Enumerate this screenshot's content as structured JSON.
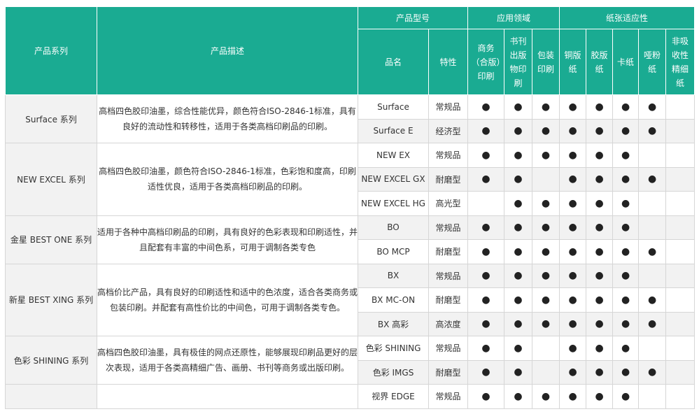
{
  "header": {
    "series": "产品系列",
    "description": "产品描述",
    "model_group": "产品型号",
    "app_group": "应用领域",
    "paper_group": "纸张适应性",
    "name": "品名",
    "feature": "特性",
    "app_cols": [
      "商务（合版）印刷",
      "书刊出版物印刷",
      "包装印刷"
    ],
    "paper_cols": [
      "铜版纸",
      "胶版纸",
      "卡纸",
      "哑粉纸",
      "非吸收性精细纸"
    ]
  },
  "groups": [
    {
      "series": "Surface 系列",
      "description": "高档四色胶印油墨，综合性能优异，颜色符合ISO-2846-1标准，具有良好的流动性和转移性，适用于各类高档印刷品的印刷。",
      "rows": [
        {
          "name": "Surface",
          "feature": "常规品",
          "marks": [
            true,
            true,
            true,
            true,
            true,
            true,
            true,
            false
          ]
        },
        {
          "name": "Surface E",
          "feature": "经济型",
          "marks": [
            true,
            true,
            true,
            true,
            true,
            true,
            true,
            false
          ]
        }
      ]
    },
    {
      "series": "NEW EXCEL 系列",
      "description": "高档四色胶印油墨，颜色符合ISO-2846-1标准，色彩饱和度高，印刷适性优良，适用于各类高档印刷品的印刷。",
      "rows": [
        {
          "name": "NEW EX",
          "feature": "常规品",
          "marks": [
            true,
            true,
            true,
            true,
            true,
            true,
            false,
            false
          ]
        },
        {
          "name": "NEW EXCEL GX",
          "feature": "耐磨型",
          "marks": [
            true,
            true,
            false,
            true,
            true,
            true,
            true,
            false
          ]
        },
        {
          "name": "NEW EXCEL HG",
          "feature": "高光型",
          "marks": [
            false,
            true,
            true,
            true,
            true,
            true,
            false,
            false
          ]
        }
      ]
    },
    {
      "series": "金星 BEST ONE 系列",
      "description": "适用于各种中高档印刷品的印刷，具有良好的色彩表现和印刷适性，并且配套有丰富的中间色系，可用于调制各类专色",
      "rows": [
        {
          "name": "BO",
          "feature": "常规品",
          "marks": [
            true,
            true,
            true,
            true,
            true,
            true,
            false,
            false
          ]
        },
        {
          "name": "BO MCP",
          "feature": "耐磨型",
          "marks": [
            true,
            true,
            true,
            true,
            true,
            true,
            true,
            false
          ]
        }
      ]
    },
    {
      "series": "新星 BEST XING 系列",
      "description": "高档价比产品，具有良好的印刷适性和适中的色浓度，适合各类商务或包装印刷。并配套有高性价比的中间色，可用于调制各类专色。",
      "rows": [
        {
          "name": "BX",
          "feature": "常规品",
          "marks": [
            true,
            true,
            true,
            true,
            true,
            true,
            false,
            false
          ]
        },
        {
          "name": "BX MC-ON",
          "feature": "耐磨型",
          "marks": [
            true,
            true,
            true,
            true,
            true,
            true,
            true,
            false
          ]
        },
        {
          "name": "BX 高彩",
          "feature": "高浓度",
          "marks": [
            true,
            true,
            true,
            true,
            true,
            true,
            true,
            false
          ]
        }
      ]
    },
    {
      "series": "色彩 SHINING 系列",
      "description": "高档四色胶印油墨，具有极佳的网点还原性，能够展现印刷品更好的层次表现，适用于各类高精细广告、画册、书刊等商务或出版印刷。",
      "rows": [
        {
          "name": "色彩 SHINING",
          "feature": "常规品",
          "marks": [
            true,
            true,
            false,
            true,
            true,
            true,
            false,
            false
          ]
        },
        {
          "name": "色彩 IMGS",
          "feature": "耐磨型",
          "marks": [
            true,
            true,
            false,
            true,
            true,
            true,
            true,
            false
          ]
        }
      ]
    },
    {
      "series": "",
      "description": "",
      "rows": [
        {
          "name": "视界 EDGE",
          "feature": "常规品",
          "marks": [
            true,
            true,
            true,
            true,
            true,
            true,
            false,
            false
          ]
        }
      ]
    }
  ],
  "dot_char": "●"
}
